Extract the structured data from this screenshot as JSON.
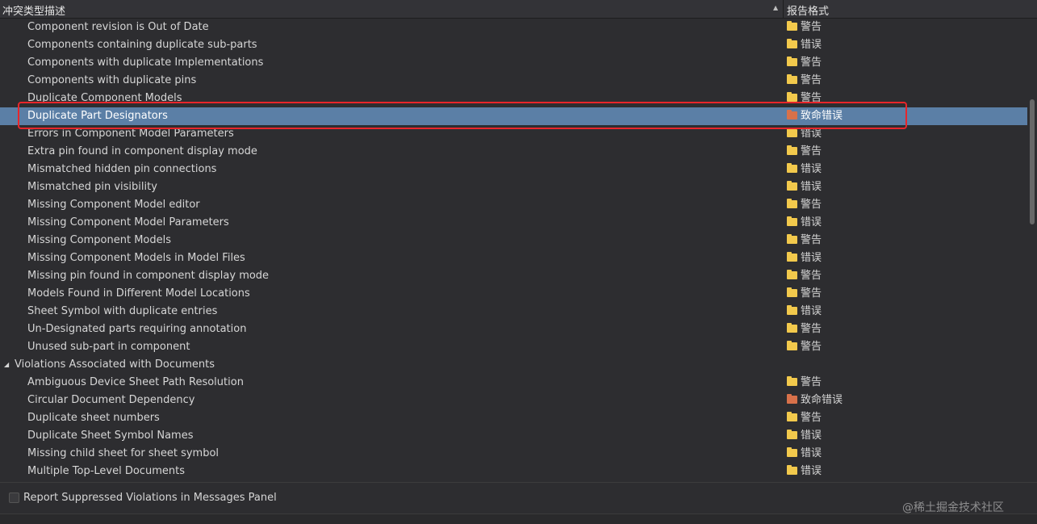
{
  "header": {
    "col_description": "冲突类型描述",
    "col_report_format": "报告格式"
  },
  "rows_top": [
    {
      "name": "Component revision is Out of Date",
      "status": "警告",
      "level": "warning"
    },
    {
      "name": "Components containing duplicate sub-parts",
      "status": "错误",
      "level": "error"
    },
    {
      "name": "Components with duplicate Implementations",
      "status": "警告",
      "level": "warning"
    },
    {
      "name": "Components with duplicate pins",
      "status": "警告",
      "level": "warning"
    },
    {
      "name": "Duplicate Component Models",
      "status": "警告",
      "level": "warning"
    },
    {
      "name": "Duplicate Part Designators",
      "status": "致命错误",
      "level": "fatal",
      "selected": true
    },
    {
      "name": "Errors in Component Model Parameters",
      "status": "错误",
      "level": "error"
    },
    {
      "name": "Extra pin found in component display mode",
      "status": "警告",
      "level": "warning"
    },
    {
      "name": "Mismatched hidden pin connections",
      "status": "错误",
      "level": "error"
    },
    {
      "name": "Mismatched pin visibility",
      "status": "错误",
      "level": "error"
    },
    {
      "name": "Missing Component Model editor",
      "status": "警告",
      "level": "warning"
    },
    {
      "name": "Missing Component Model Parameters",
      "status": "错误",
      "level": "error"
    },
    {
      "name": "Missing Component Models",
      "status": "警告",
      "level": "warning"
    },
    {
      "name": "Missing Component Models in Model Files",
      "status": "错误",
      "level": "error"
    },
    {
      "name": "Missing pin found in component display mode",
      "status": "警告",
      "level": "warning"
    },
    {
      "name": "Models Found in Different Model Locations",
      "status": "警告",
      "level": "warning"
    },
    {
      "name": "Sheet Symbol with duplicate entries",
      "status": "错误",
      "level": "error"
    },
    {
      "name": "Un-Designated parts requiring annotation",
      "status": "警告",
      "level": "warning"
    },
    {
      "name": "Unused sub-part in component",
      "status": "警告",
      "level": "warning"
    }
  ],
  "group": {
    "label": "Violations Associated with Documents"
  },
  "rows_docs": [
    {
      "name": "Ambiguous Device Sheet Path Resolution",
      "status": "警告",
      "level": "warning"
    },
    {
      "name": "Circular Document Dependency",
      "status": "致命错误",
      "level": "fatal"
    },
    {
      "name": "Duplicate sheet numbers",
      "status": "警告",
      "level": "warning"
    },
    {
      "name": "Duplicate Sheet Symbol Names",
      "status": "错误",
      "level": "error"
    },
    {
      "name": "Missing child sheet for sheet symbol",
      "status": "错误",
      "level": "error"
    },
    {
      "name": "Multiple Top-Level Documents",
      "status": "错误",
      "level": "error"
    }
  ],
  "footer": {
    "checkbox_label": "Report Suppressed Violations in Messages Panel"
  },
  "watermark": "@稀土掘金技术社区",
  "colors": {
    "selected_row": "#5b7fa6",
    "highlight_box": "#e8262b",
    "folder_warning": "#f2c94c",
    "folder_fatal": "#d8714a"
  }
}
